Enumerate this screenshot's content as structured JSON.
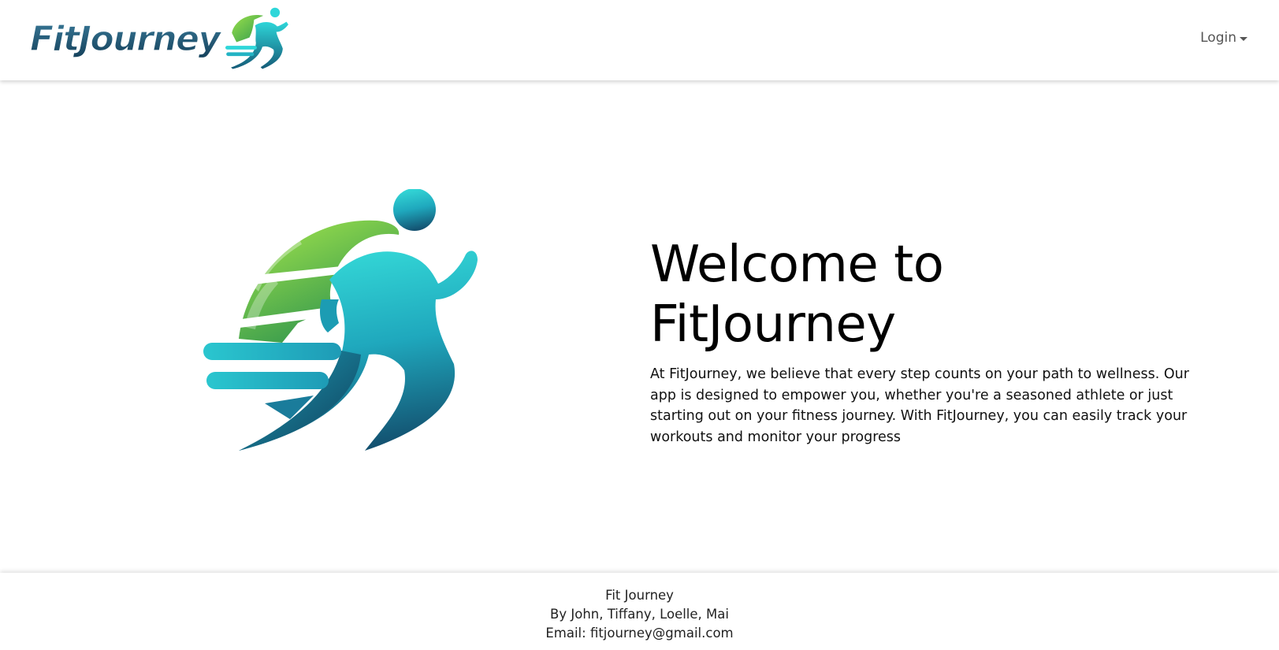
{
  "navbar": {
    "brand_text": "FitJourney",
    "login_label": "Login"
  },
  "hero": {
    "title_line1": "Welcome to",
    "title_line2": "FitJourney",
    "description": "At FitJourney, we believe that every step counts on your path to wellness. Our app is designed to empower you, whether you're a seasoned athlete or just starting out on your fitness journey. With FitJourney, you can easily track your workouts and monitor your progress",
    "logo_icon": "running-man-logo"
  },
  "footer": {
    "name": "Fit Journey",
    "authors": "By John, Tiffany, Loelle, Mai",
    "email": "Email: fitjourney@gmail.com"
  },
  "colors": {
    "green_light": "#9be04a",
    "green_dark": "#2f9a4e",
    "teal_light": "#2ed6d9",
    "teal_dark": "#155b78",
    "brand_text": "#1f4f6b"
  }
}
